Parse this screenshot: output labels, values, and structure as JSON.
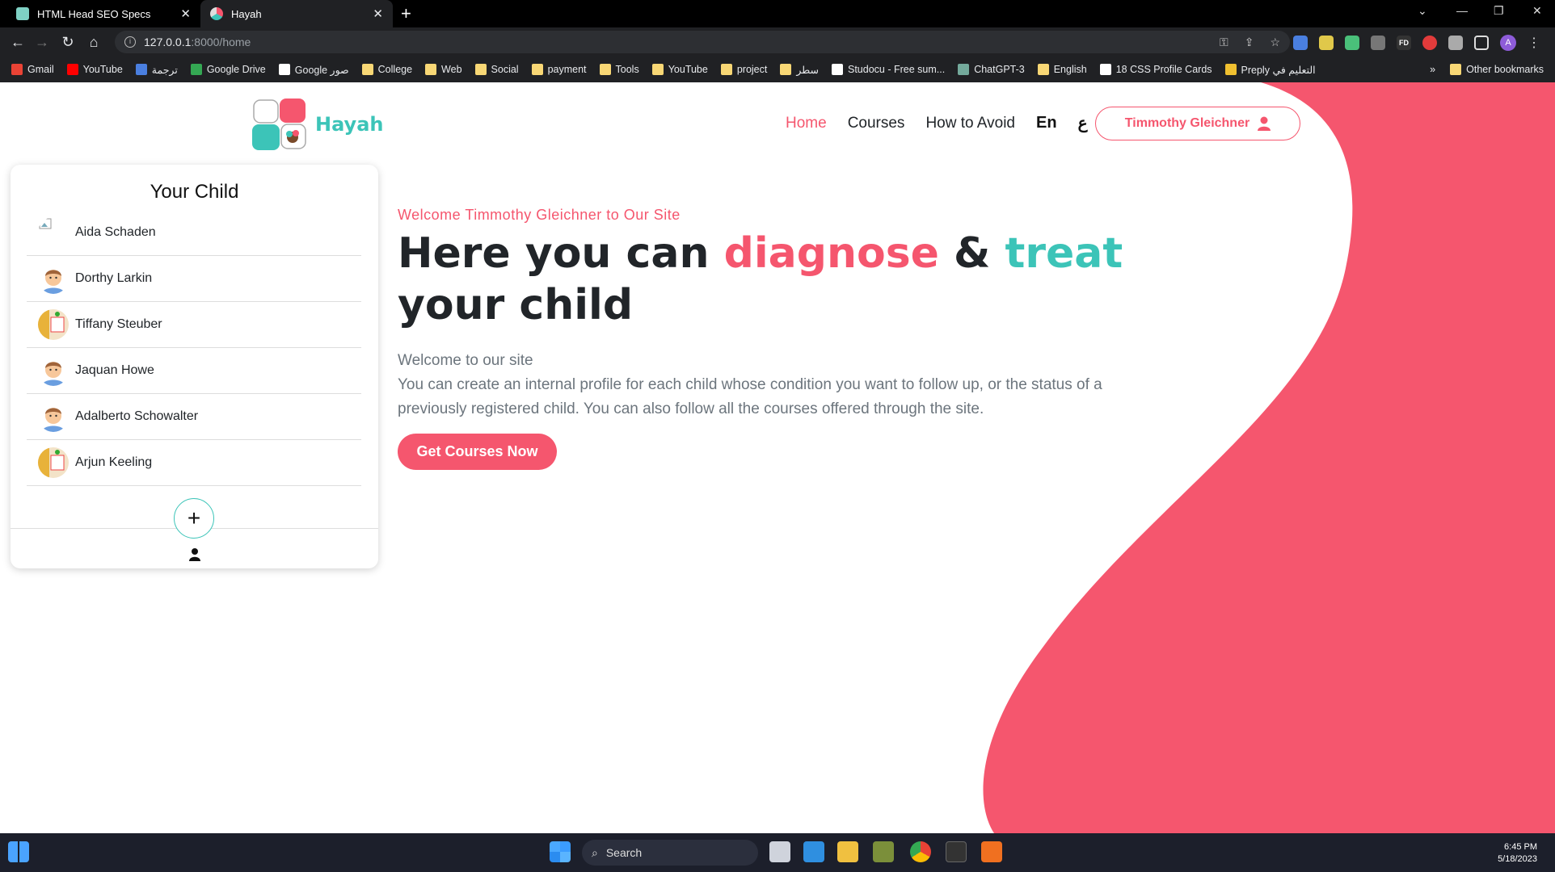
{
  "browser": {
    "tabs": [
      {
        "title": "HTML Head SEO Specs",
        "active": false
      },
      {
        "title": "Hayah",
        "active": true
      }
    ],
    "url_host": "127.0.0.1",
    "url_path": ":8000/home",
    "bookmarks": [
      {
        "label": "Gmail",
        "icon": "gmail-icon"
      },
      {
        "label": "YouTube",
        "icon": "youtube-icon"
      },
      {
        "label": "ترجمة",
        "icon": "translate-icon"
      },
      {
        "label": "Google Drive",
        "icon": "drive-icon"
      },
      {
        "label": "Google صور",
        "icon": "google-icon"
      },
      {
        "label": "College",
        "icon": "folder-icon"
      },
      {
        "label": "Web",
        "icon": "folder-icon"
      },
      {
        "label": "Social",
        "icon": "folder-icon"
      },
      {
        "label": "payment",
        "icon": "folder-icon"
      },
      {
        "label": "Tools",
        "icon": "folder-icon"
      },
      {
        "label": "YouTube",
        "icon": "folder-icon"
      },
      {
        "label": "project",
        "icon": "folder-icon"
      },
      {
        "label": "سطر",
        "icon": "folder-icon"
      },
      {
        "label": "Studocu - Free sum...",
        "icon": "studocu-icon"
      },
      {
        "label": "ChatGPT-3",
        "icon": "chatgpt-icon"
      },
      {
        "label": "English",
        "icon": "folder-icon"
      },
      {
        "label": "18 CSS Profile Cards",
        "icon": "cssprofile-icon"
      },
      {
        "label": "Preply التعليم في",
        "icon": "preply-icon"
      }
    ],
    "bookmarks_more": "»",
    "other_bookmarks": "Other bookmarks",
    "profile_initial": "A"
  },
  "site": {
    "logo_text": "Hayah",
    "nav": [
      {
        "label": "Home",
        "active": true
      },
      {
        "label": "Courses",
        "active": false
      },
      {
        "label": "How to Avoid",
        "active": false
      }
    ],
    "lang_en": "En",
    "lang_ar": "ع",
    "user_name": "Timmothy Gleichner"
  },
  "child_card": {
    "title": "Your Child",
    "children": [
      {
        "name": "Aida Schaden",
        "avatar": "broken-image"
      },
      {
        "name": "Dorthy Larkin",
        "avatar": "boy-avatar"
      },
      {
        "name": "Tiffany Steuber",
        "avatar": "photo-avatar"
      },
      {
        "name": "Jaquan Howe",
        "avatar": "boy-avatar"
      },
      {
        "name": "Adalberto Schowalter",
        "avatar": "boy-avatar"
      },
      {
        "name": "Arjun Keeling",
        "avatar": "photo-avatar"
      }
    ],
    "add_label": "+"
  },
  "hero": {
    "welcome": "Welcome Timmothy Gleichner to Our Site",
    "title_part1": "Here you can ",
    "title_diagnose": "diagnose",
    "title_amp": " & ",
    "title_treat": "treat",
    "title_part2": " your child",
    "desc_line1": "Welcome to our site",
    "desc_line2": "You can create an internal profile for each child whose condition you want to follow up, or the status of a previously registered child. You can also follow all the courses offered through the site.",
    "cta": "Get Courses Now"
  },
  "taskbar": {
    "search_label": "Search",
    "time": "6:45 PM",
    "date": "5/18/2023"
  },
  "colors": {
    "brand_pink": "#f5566e",
    "brand_teal": "#3cc4b8"
  }
}
